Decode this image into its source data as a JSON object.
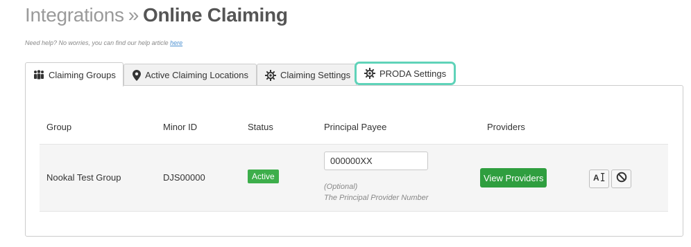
{
  "header": {
    "breadcrumb_parent": "Integrations",
    "separator": "»",
    "title": "Online Claiming"
  },
  "help": {
    "text": "Need help? No worries, you can find our help article ",
    "link": "here"
  },
  "tabs": [
    {
      "label": "Claiming Groups",
      "icon": "users-icon",
      "active": true
    },
    {
      "label": "Active Claiming Locations",
      "icon": "map-pin-icon",
      "active": false
    },
    {
      "label": "Claiming Settings",
      "icon": "gear-icon",
      "active": false
    },
    {
      "label": "PRODA Settings",
      "icon": "gear-icon",
      "active": false,
      "highlighted": true
    }
  ],
  "table": {
    "columns": [
      "Group",
      "Minor ID",
      "Status",
      "Principal Payee",
      "Providers"
    ],
    "rows": [
      {
        "group": "Nookal Test Group",
        "minor_id": "DJS00000",
        "status": "Active",
        "principal_payee": "000000XX",
        "payee_hint_1": "(Optional)",
        "payee_hint_2": "The Principal Provider Number",
        "providers_button": "View Providers",
        "actions": [
          "rename-icon",
          "disable-icon"
        ]
      }
    ]
  },
  "colors": {
    "status_active": "#3dae4b",
    "button_green": "#2f9e3f",
    "highlight": "#5fd3b9"
  }
}
